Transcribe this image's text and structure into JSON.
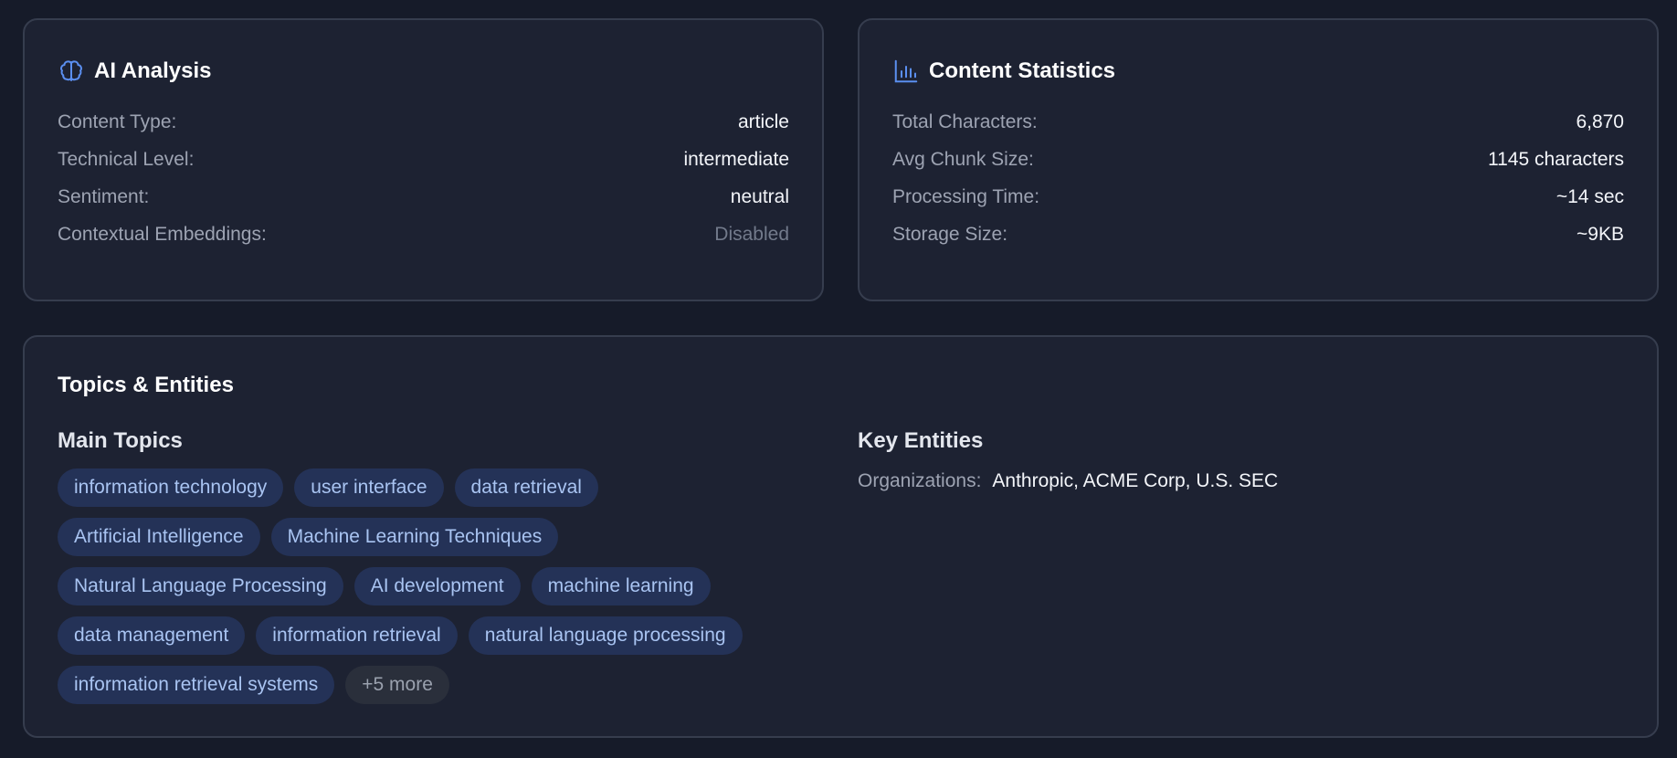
{
  "ai_analysis": {
    "title": "AI Analysis",
    "icon": "brain-icon",
    "rows": [
      {
        "label": "Content Type:",
        "value": "article"
      },
      {
        "label": "Technical Level:",
        "value": "intermediate"
      },
      {
        "label": "Sentiment:",
        "value": "neutral"
      },
      {
        "label": "Contextual Embeddings:",
        "value": "Disabled"
      }
    ]
  },
  "content_stats": {
    "title": "Content Statistics",
    "icon": "bar-chart-icon",
    "rows": [
      {
        "label": "Total Characters:",
        "value": "6,870"
      },
      {
        "label": "Avg Chunk Size:",
        "value": "1145 characters"
      },
      {
        "label": "Processing Time:",
        "value": "~14 sec"
      },
      {
        "label": "Storage Size:",
        "value": "~9KB"
      }
    ]
  },
  "topics_entities": {
    "title": "Topics & Entities",
    "main_topics": {
      "heading": "Main Topics",
      "tags": [
        "information technology",
        "user interface",
        "data retrieval",
        "Artificial Intelligence",
        "Machine Learning Techniques",
        "Natural Language Processing",
        "AI development",
        "machine learning",
        "data management",
        "information retrieval",
        "natural language processing",
        "information retrieval systems"
      ],
      "more_label": "+5 more"
    },
    "key_entities": {
      "heading": "Key Entities",
      "organizations_label": "Organizations:",
      "organizations_value": "Anthropic, ACME Corp, U.S. SEC"
    }
  },
  "colors": {
    "background": "#161b29",
    "card": "#1d2232",
    "card_border": "#363d4e",
    "tag_bg": "#243257",
    "tag_text": "#a9c4f2",
    "icon_accent": "#5b8ff0"
  }
}
